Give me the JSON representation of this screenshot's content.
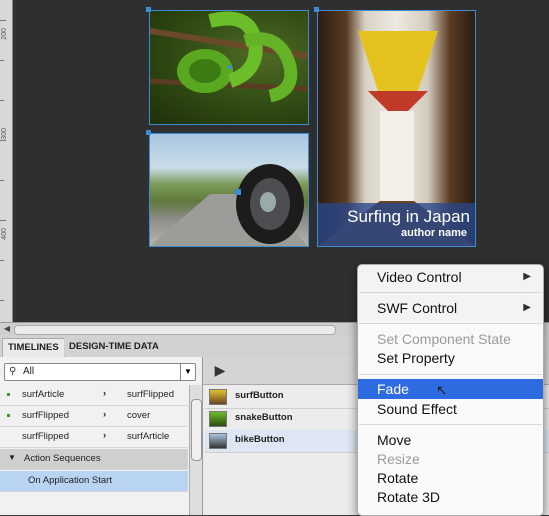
{
  "stage": {
    "ruler_labels": [
      "200",
      "300",
      "400"
    ],
    "hall_tile": {
      "title": "Surfing in Japan",
      "author": "author name"
    }
  },
  "panel": {
    "tabs": [
      "TIMELINES",
      "DESIGN-TIME DATA"
    ],
    "search": {
      "value": "All",
      "icon": "search-icon"
    },
    "timeline_rows": [
      {
        "from": "surfArticle",
        "to": "surfFlipped",
        "dot": true
      },
      {
        "from": "surfFlipped",
        "to": "cover",
        "dot": true
      },
      {
        "from": "surfFlipped",
        "to": "surfArticle",
        "dot": false
      }
    ],
    "action_sequences_label": "Action Sequences",
    "on_start_label": "On Application Start",
    "buttons": [
      "surfButton",
      "snakeButton",
      "bikeButton"
    ]
  },
  "context_menu": {
    "items": [
      {
        "label": "Video Control",
        "submenu": true,
        "disabled": false
      },
      {
        "label": "SWF Control",
        "submenu": true,
        "disabled": false
      },
      {
        "label": "Set Component State",
        "submenu": false,
        "disabled": true
      },
      {
        "label": "Set Property",
        "submenu": false,
        "disabled": false
      },
      {
        "label": "Fade",
        "submenu": false,
        "disabled": false,
        "selected": true
      },
      {
        "label": "Sound Effect",
        "submenu": false,
        "disabled": false
      },
      {
        "label": "Move",
        "submenu": false,
        "disabled": false
      },
      {
        "label": "Resize",
        "submenu": false,
        "disabled": true
      },
      {
        "label": "Rotate",
        "submenu": false,
        "disabled": false
      },
      {
        "label": "Rotate 3D",
        "submenu": false,
        "disabled": false
      }
    ],
    "submenu_arrow": "▶"
  },
  "colors": {
    "selection": "#2f6be0",
    "tile_border": "#3d8cd6",
    "caption_bg": "#284690"
  }
}
